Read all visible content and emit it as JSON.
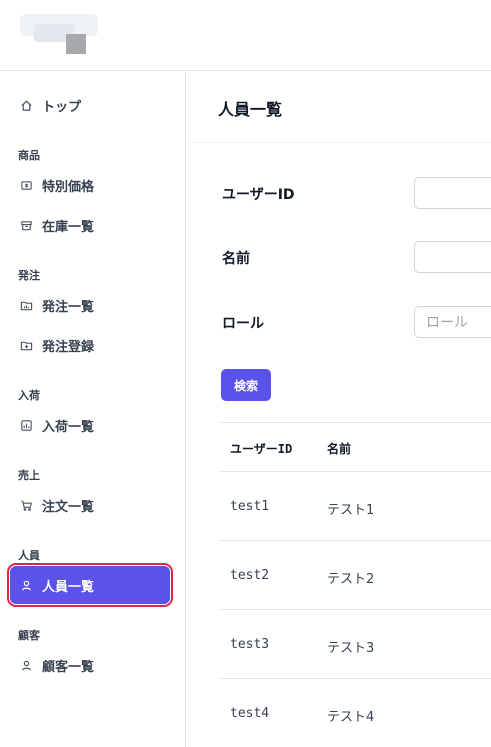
{
  "sidebar": {
    "top_label": "トップ",
    "sections": {
      "products": "商品",
      "orders": "発注",
      "arrivals": "入荷",
      "sales": "売上",
      "staff": "人員",
      "customers": "顧客"
    },
    "items": {
      "special_price": "特別価格",
      "stock_list": "在庫一覧",
      "order_list": "発注一覧",
      "order_register": "発注登録",
      "arrival_list": "入荷一覧",
      "sales_order_list": "注文一覧",
      "staff_list": "人員一覧",
      "customer_list": "顧客一覧"
    },
    "active_item": "staff_list",
    "accent_color": "#5b52ea",
    "highlight_color": "#dc2648"
  },
  "main": {
    "title": "人員一覧",
    "form": {
      "user_id_label": "ユーザーID",
      "name_label": "名前",
      "role_label": "ロール",
      "user_id_value": "",
      "name_value": "",
      "role_placeholder": "ロール"
    },
    "search_label": "検索",
    "table": {
      "headers": [
        "ユーザーID",
        "名前"
      ],
      "rows": [
        {
          "id": "test1",
          "name": "テスト1"
        },
        {
          "id": "test2",
          "name": "テスト2"
        },
        {
          "id": "test3",
          "name": "テスト3"
        },
        {
          "id": "test4",
          "name": "テスト4"
        }
      ]
    }
  }
}
